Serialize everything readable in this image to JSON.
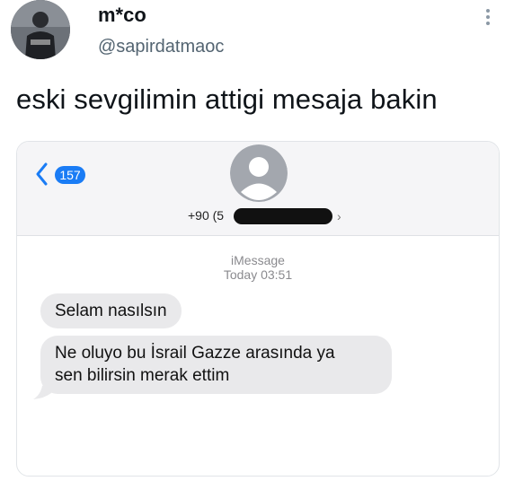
{
  "tweet": {
    "display_name": "m*co",
    "handle": "@sapirdatmaoc",
    "text": "eski sevgilimin attigi mesaja bakin"
  },
  "messages_screen": {
    "unread_count": "157",
    "contact_number": "+90 (5",
    "service": "iMessage",
    "timestamp": "Today 03:51",
    "bubbles": [
      {
        "text": "Selam nasılsın"
      },
      {
        "line1": "Ne oluyo bu İsrail Gazze arasında ya",
        "line2": "sen bilirsin merak ettim"
      }
    ]
  },
  "colors": {
    "accent": "#1a7cf5",
    "bubble": "#e9e9eb",
    "handle": "#536471"
  },
  "icons": [
    "more-vertical-icon",
    "back-chevron-icon",
    "contact-silhouette-icon",
    "chevron-right-icon"
  ]
}
